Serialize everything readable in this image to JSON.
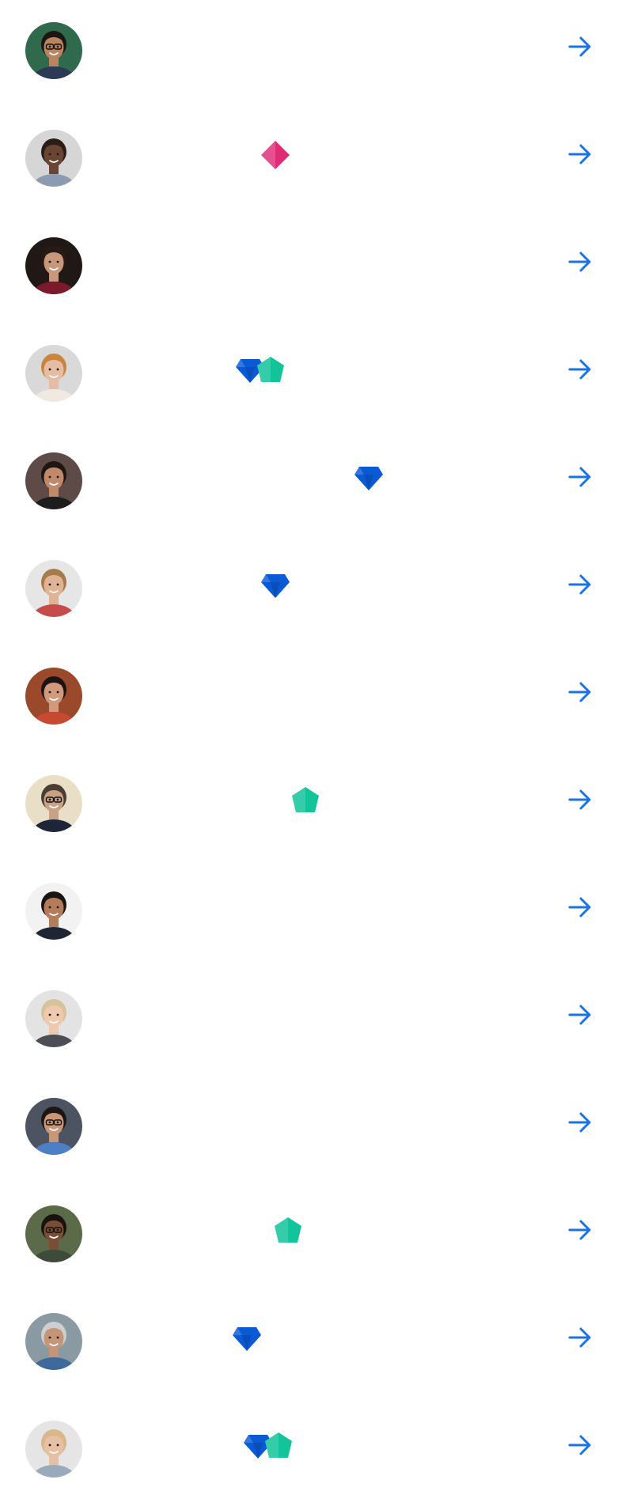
{
  "accent_color": "#1a73e8",
  "gem_colors": {
    "pink-gem": "#e02b76",
    "blue-gem": "#0a5ad6",
    "teal-gem": "#12c49a"
  },
  "rows": [
    {
      "avatar": {
        "skin": "#b98561",
        "hair": "#1c1512",
        "bg": "#2f6a4c",
        "shirt": "#2b3a55",
        "glasses": true
      },
      "badges": []
    },
    {
      "avatar": {
        "skin": "#6b4533",
        "hair": "#2a1d16",
        "bg": "#d6d6d6",
        "shirt": "#8a9bb2",
        "glasses": false
      },
      "badges": [
        "pink-gem"
      ]
    },
    {
      "avatar": {
        "skin": "#c7987a",
        "hair": "#2a1a14",
        "bg": "#201814",
        "shirt": "#7a1a2a",
        "glasses": false
      },
      "badges": []
    },
    {
      "avatar": {
        "skin": "#e6bda4",
        "hair": "#c9843e",
        "bg": "#d9d9d9",
        "shirt": "#efe9e2",
        "glasses": false
      },
      "badges": [
        "blue-gem",
        "teal-gem"
      ]
    },
    {
      "avatar": {
        "skin": "#c08a6a",
        "hair": "#1f1612",
        "bg": "#5e4b47",
        "shirt": "#1d1d1d",
        "glasses": false
      },
      "badges": [
        "blue-gem"
      ]
    },
    {
      "avatar": {
        "skin": "#e0b394",
        "hair": "#a67a4b",
        "bg": "#e6e6e6",
        "shirt": "#c64b4b",
        "glasses": false
      },
      "badges": [
        "blue-gem"
      ]
    },
    {
      "avatar": {
        "skin": "#d19a7c",
        "hair": "#1a1414",
        "bg": "#9a4a2a",
        "shirt": "#c7492f",
        "glasses": false
      },
      "badges": []
    },
    {
      "avatar": {
        "skin": "#c9a184",
        "hair": "#4a3d33",
        "bg": "#e9dfc7",
        "shirt": "#1d2538",
        "glasses": true
      },
      "badges": [
        "teal-gem"
      ]
    },
    {
      "avatar": {
        "skin": "#b47c5a",
        "hair": "#1a1412",
        "bg": "#f2f2f2",
        "shirt": "#1f2633",
        "glasses": false
      },
      "badges": []
    },
    {
      "avatar": {
        "skin": "#efc9ae",
        "hair": "#d8c29a",
        "bg": "#e3e3e3",
        "shirt": "#4d4d55",
        "glasses": false
      },
      "badges": []
    },
    {
      "avatar": {
        "skin": "#c99775",
        "hair": "#1c1614",
        "bg": "#4c5462",
        "shirt": "#4d7fc4",
        "glasses": true
      },
      "badges": []
    },
    {
      "avatar": {
        "skin": "#7a4e34",
        "hair": "#1a120e",
        "bg": "#5b6b4a",
        "shirt": "#3e4a3a",
        "glasses": true
      },
      "badges": [
        "teal-gem"
      ]
    },
    {
      "avatar": {
        "skin": "#c59577",
        "hair": "#cfcfcf",
        "bg": "#8a9aa2",
        "shirt": "#3d6a9a",
        "glasses": false
      },
      "badges": [
        "blue-gem"
      ]
    },
    {
      "avatar": {
        "skin": "#e6bfa4",
        "hair": "#d8b88a",
        "bg": "#e5e5e5",
        "shirt": "#9ab",
        "glasses": false
      },
      "badges": [
        "blue-gem",
        "teal-gem"
      ]
    }
  ]
}
